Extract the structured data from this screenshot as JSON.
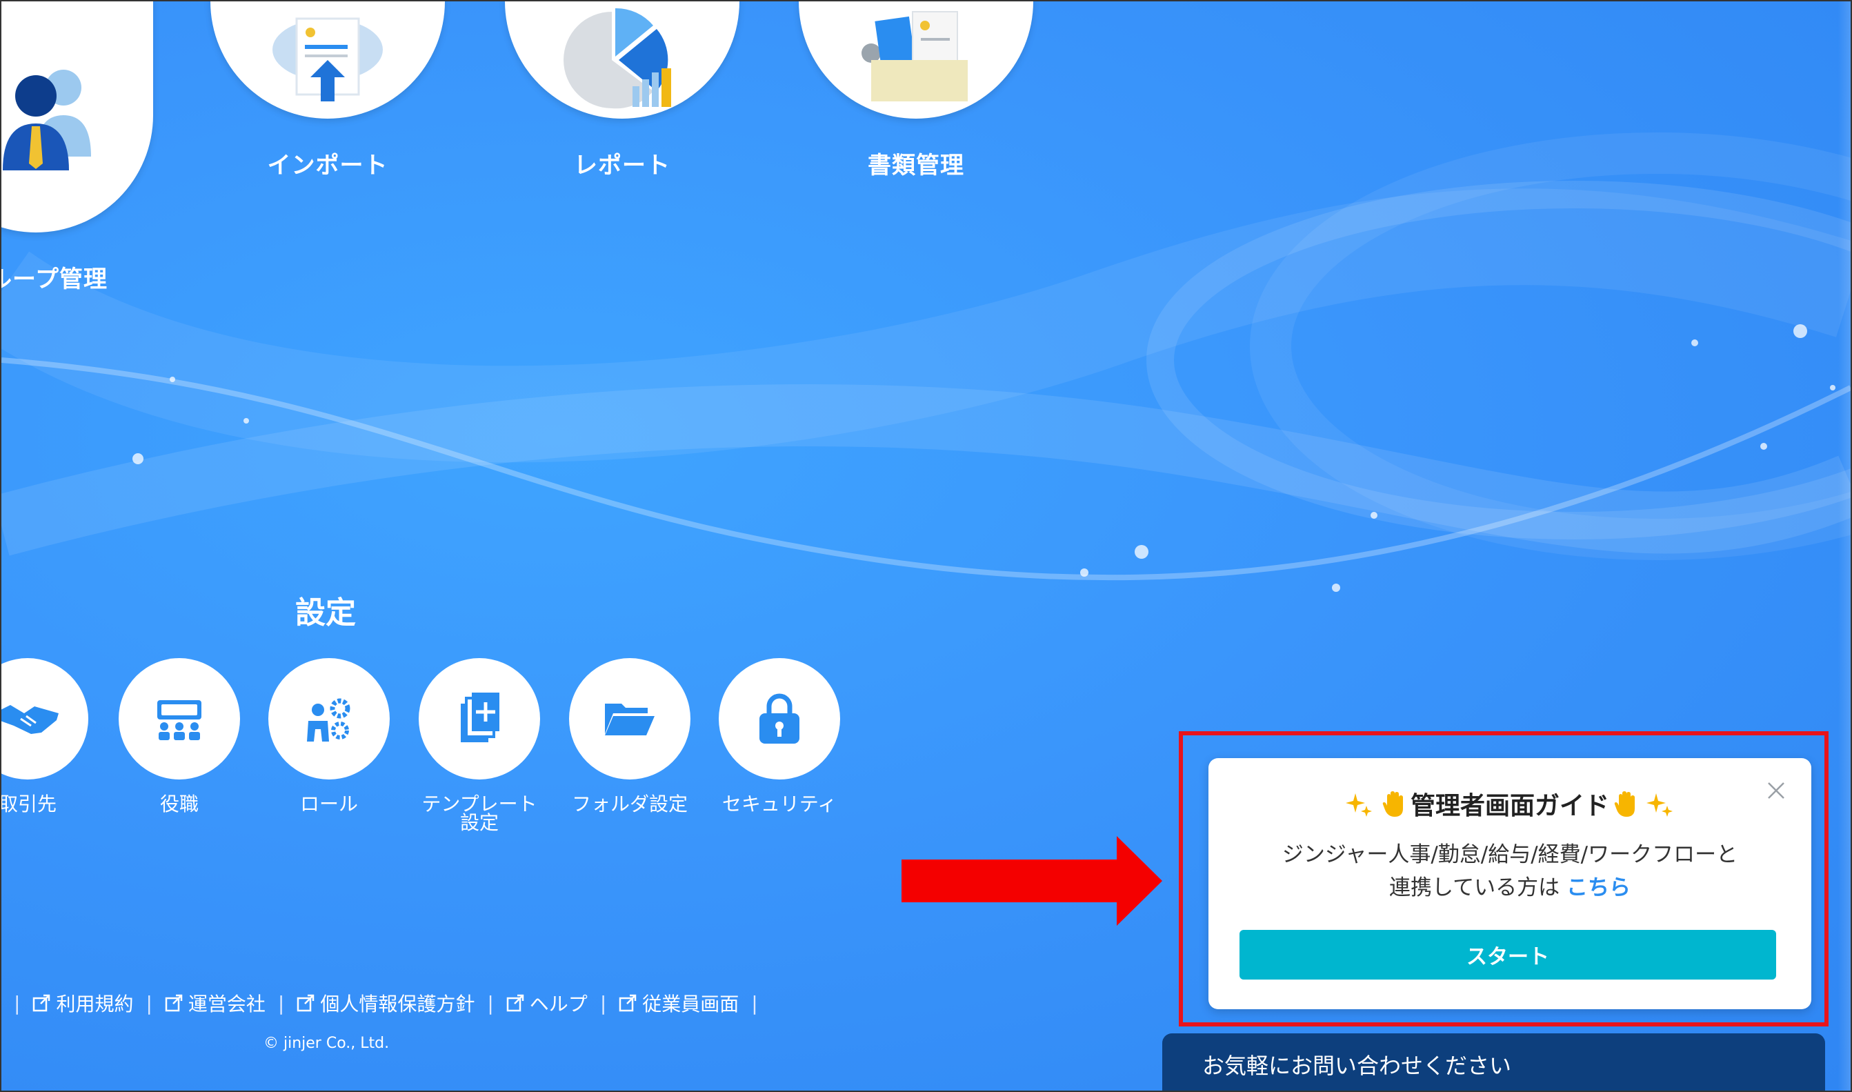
{
  "apps": [
    {
      "label": "グループ管理",
      "icon": "group-icon"
    },
    {
      "label": "インポート",
      "icon": "import-icon"
    },
    {
      "label": "レポート",
      "icon": "report-icon"
    },
    {
      "label": "書類管理",
      "icon": "document-management-icon"
    }
  ],
  "settings": {
    "title": "設定",
    "items": [
      {
        "label": "取引先",
        "icon": "handshake-icon"
      },
      {
        "label": "役職",
        "icon": "position-icon"
      },
      {
        "label": "ロール",
        "icon": "role-icon"
      },
      {
        "label": "テンプレート\n設定",
        "line1": "テンプレート",
        "line2": "設定",
        "icon": "template-icon"
      },
      {
        "label": "フォルダ設定",
        "icon": "folder-icon"
      },
      {
        "label": "セキュリティ",
        "icon": "lock-icon"
      }
    ]
  },
  "footer": {
    "links": [
      "利用規約",
      "運営会社",
      "個人情報保護方針",
      "ヘルプ",
      "従業員画面"
    ],
    "copyright": "© jinjer Co., Ltd."
  },
  "guide": {
    "title": "管理者画面ガイド",
    "text_line1": "ジンジャー人事/勤怠/給与/経費/ワークフローと",
    "text_line2": "連携している方は",
    "link": "こちら",
    "start_button": "スタート"
  },
  "contact": {
    "label": "お気軽にお問い合わせください"
  },
  "colors": {
    "background": "#3a95fb",
    "accent_teal": "#00b6cf",
    "link_blue": "#2a8df0",
    "highlight_red": "#e8141b",
    "contact_navy": "#0d3f7d"
  }
}
